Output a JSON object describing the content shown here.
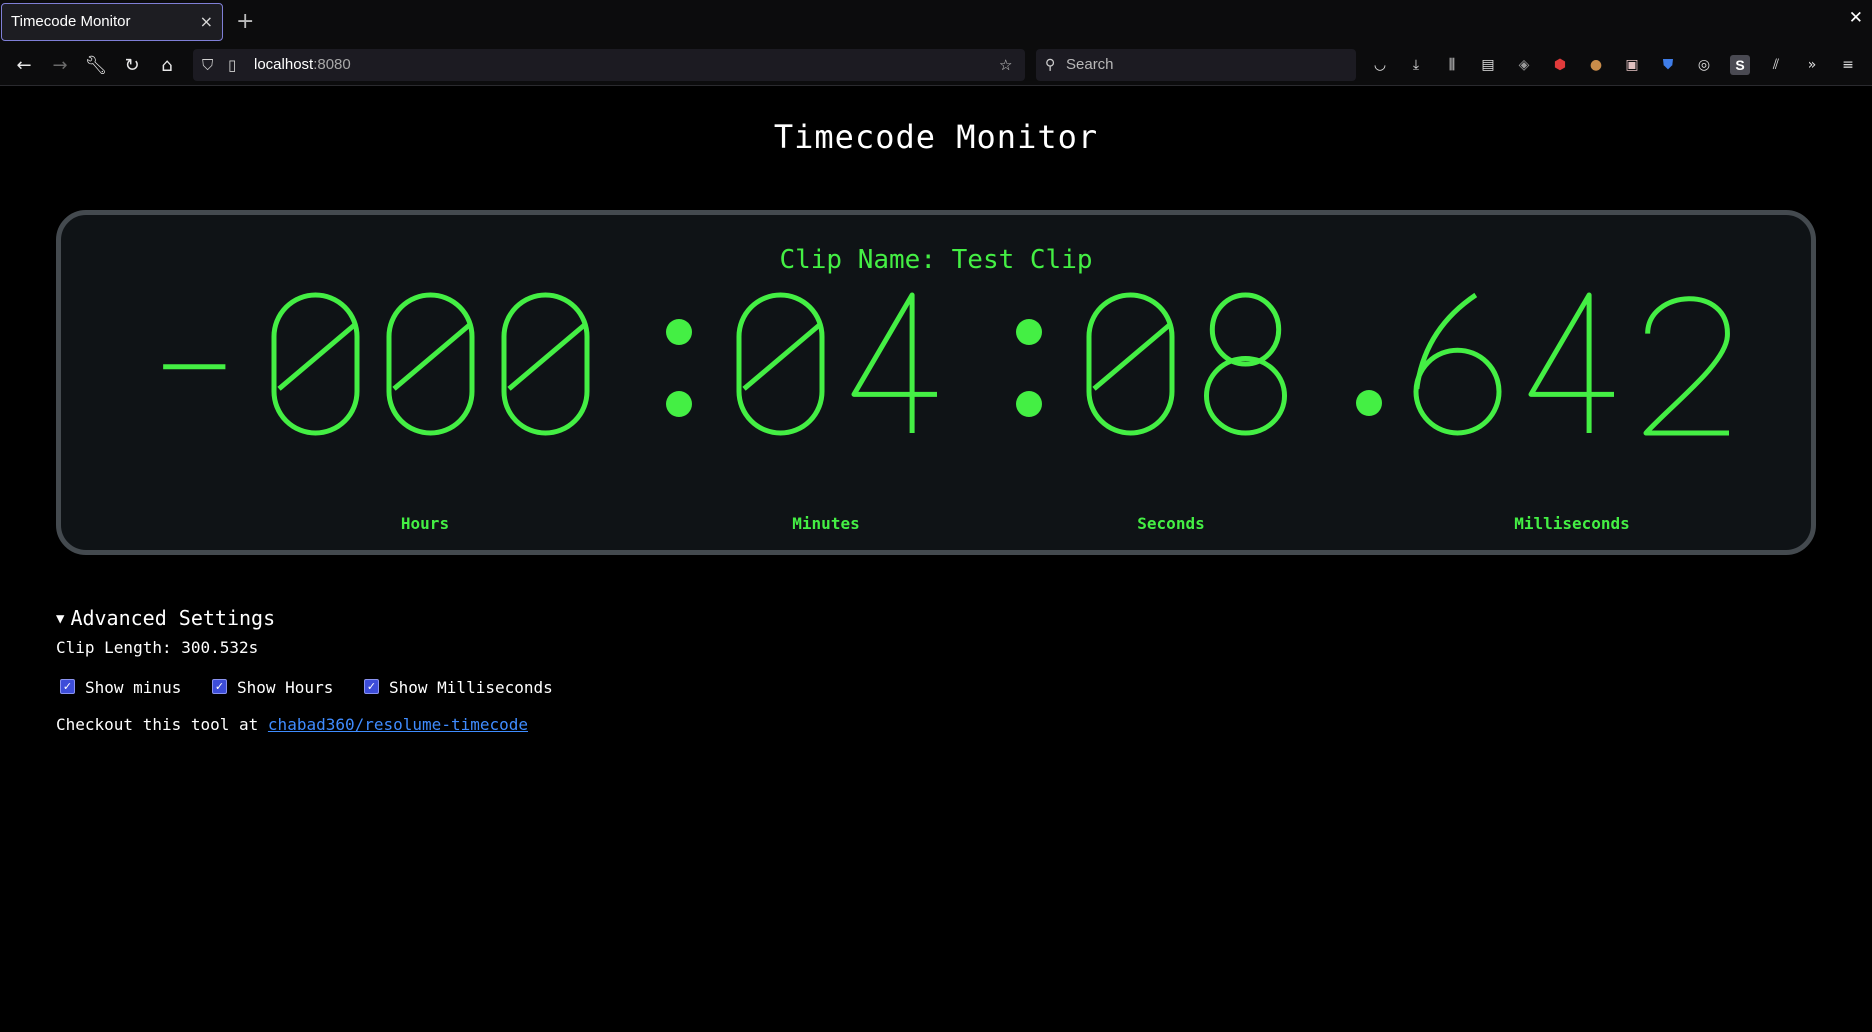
{
  "browser": {
    "tab_title": "Timecode Monitor",
    "tab_close_icon": "×",
    "new_tab_icon": "+",
    "window_close_icon": "✕",
    "url_host": "localhost",
    "url_port": ":8080",
    "search_placeholder": "Search",
    "toolbar_icons": [
      "pocket-icon",
      "download-icon",
      "library-icon",
      "reader-view-icon",
      "privacy-badger-icon",
      "ublock-origin-icon",
      "cookie-icon",
      "extension-icon",
      "bitwarden-icon",
      "incognito-icon",
      "stylus-icon",
      "zotero-icon",
      "overflow-icon",
      "menu-icon"
    ]
  },
  "page": {
    "title": "Timecode Monitor",
    "clip_name_label": "Clip Name: ",
    "clip_name": "Test Clip",
    "timecode": "-000:04:08.642",
    "timecode_color": "#44ef44",
    "labels": {
      "hours": "Hours",
      "minutes": "Minutes",
      "seconds": "Seconds",
      "milliseconds": "Milliseconds"
    },
    "advanced": {
      "summary": "Advanced Settings",
      "clip_length_label": "Clip Length: ",
      "clip_length": "300.532s",
      "options": [
        {
          "label": "Show minus",
          "checked": true
        },
        {
          "label": "Show Hours",
          "checked": true
        },
        {
          "label": "Show Milliseconds",
          "checked": true
        }
      ]
    },
    "footer_prefix": "Checkout this tool at ",
    "footer_link": "chabad360/resolume-timecode"
  }
}
